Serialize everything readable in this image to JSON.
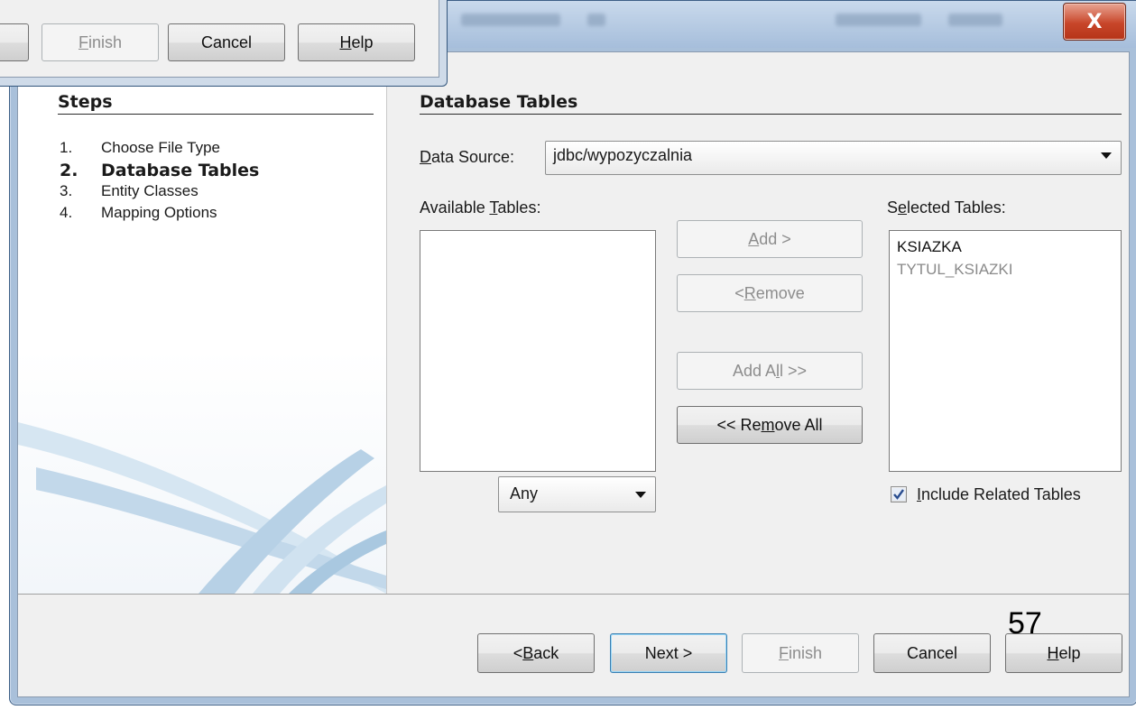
{
  "prev_dialog": {
    "finish_label": "Finish",
    "cancel_label": "Cancel",
    "help_label": "Help"
  },
  "window": {
    "close_label": "X"
  },
  "steps": {
    "heading": "Steps",
    "items": [
      {
        "num": "1.",
        "label": "Choose File Type"
      },
      {
        "num": "2.",
        "label": "Database Tables"
      },
      {
        "num": "3.",
        "label": "Entity Classes"
      },
      {
        "num": "4.",
        "label": "Mapping Options"
      }
    ],
    "active_index": 1
  },
  "main": {
    "heading": "Database Tables",
    "data_source_label": "Data Source:",
    "data_source_value": "jdbc/wypozyczalnia",
    "available_label": "Available Tables:",
    "selected_label": "Selected Tables:",
    "available_tables": [],
    "selected_tables": [
      {
        "name": "KSIAZKA",
        "dimmed": false
      },
      {
        "name": "TYTUL_KSIAZKI",
        "dimmed": true
      }
    ],
    "filter_value": "Any",
    "add_label": "Add >",
    "remove_label": "< Remove",
    "add_all_label": "Add All >>",
    "remove_all_label": "<< Remove All",
    "include_related_label": "Include Related Tables",
    "include_related_checked": true
  },
  "footer": {
    "back_label": "< Back",
    "next_label": "Next >",
    "finish_label": "Finish",
    "cancel_label": "Cancel",
    "help_label": "Help"
  },
  "slide_number": "57"
}
